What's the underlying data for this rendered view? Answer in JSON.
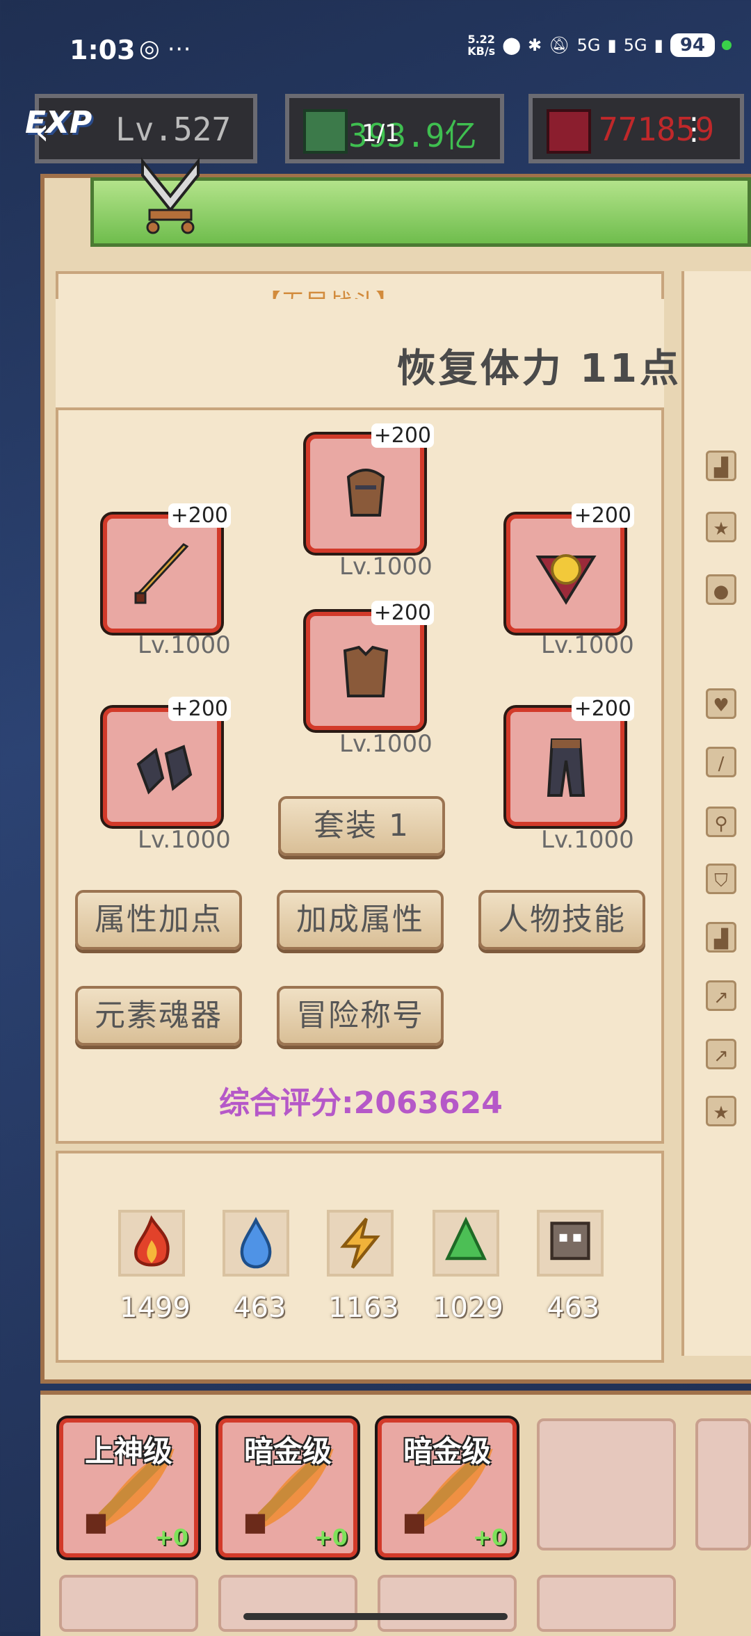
{
  "status_bar": {
    "time": "1:03",
    "net_speed_top": "5.22",
    "net_speed_bottom": "KB/s",
    "battery": "94",
    "sig1": "5G",
    "sig2": "5G"
  },
  "overlay": {
    "page_indicator": "1/1"
  },
  "resources": {
    "exp_badge": "EXP",
    "level": "Lv.527",
    "gems": "393.9亿",
    "rubies": "771859"
  },
  "panel": {
    "partial_title": "【无尽战斗】",
    "stamina_text": "恢复体力 11点"
  },
  "equipment": [
    {
      "name": "helmet",
      "plus": "+200",
      "level": "Lv.1000"
    },
    {
      "name": "weapon",
      "plus": "+200",
      "level": "Lv.1000"
    },
    {
      "name": "amulet",
      "plus": "+200",
      "level": "Lv.1000"
    },
    {
      "name": "armor",
      "plus": "+200",
      "level": "Lv.1000"
    },
    {
      "name": "gloves",
      "plus": "+200",
      "level": "Lv.1000"
    },
    {
      "name": "pants",
      "plus": "+200",
      "level": "Lv.1000"
    }
  ],
  "buttons": {
    "set": "套装 1",
    "attr_points": "属性加点",
    "bonus_attr": "加成属性",
    "skills": "人物技能",
    "soul": "元素魂器",
    "title": "冒险称号"
  },
  "score": "综合评分:2063624",
  "elements": [
    {
      "icon": "fire-icon",
      "value": "1499",
      "color": "#e2422a"
    },
    {
      "icon": "water-icon",
      "value": "463",
      "color": "#4f93e6"
    },
    {
      "icon": "lightning-icon",
      "value": "1163",
      "color": "#f0b23a"
    },
    {
      "icon": "wind-icon",
      "value": "1029",
      "color": "#4cbf55"
    },
    {
      "icon": "dark-icon",
      "value": "463",
      "color": "#7a6b62"
    }
  ],
  "inventory": [
    {
      "grade": "上神级",
      "plus": "+0"
    },
    {
      "grade": "暗金级",
      "plus": "+0"
    },
    {
      "grade": "暗金级",
      "plus": "+0"
    }
  ]
}
